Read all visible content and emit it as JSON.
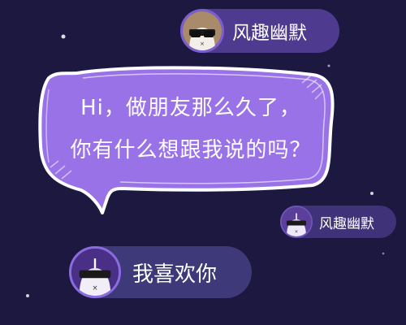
{
  "top_pill": {
    "label": "风趣幽默"
  },
  "mid_pill": {
    "label": "风趣幽默"
  },
  "bottom_pill": {
    "label": "我喜欢你"
  },
  "bubble": {
    "line1": "Hi，做朋友那么久了，",
    "line2": "你有什么想跟我说的吗？"
  },
  "colors": {
    "background": "#1c1840",
    "bubble_fill": "#9a72e8",
    "bubble_outline": "#ffffff",
    "pill_top": "#4e3b8f",
    "pill_bottom": "#3e3a7a"
  },
  "icons": [
    "avatar-cat-sunglasses-icon",
    "sparkle-star-icon"
  ]
}
